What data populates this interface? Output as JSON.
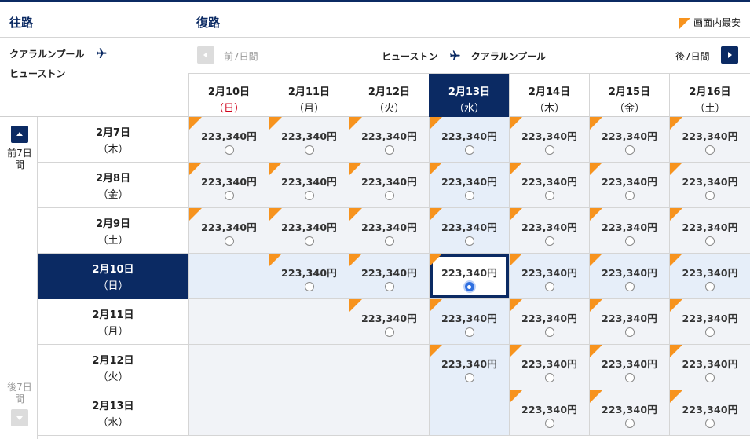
{
  "outbound_title": "往路",
  "return_title": "復路",
  "legend_label": "画面内最安",
  "colors": {
    "navy": "#0b2a63",
    "orange": "#f7931e",
    "red_date": "#d0021b"
  },
  "outbound_route": {
    "from": "クアラルンプール",
    "to": "ヒューストン"
  },
  "return_route": {
    "from": "ヒューストン",
    "to": "クアラルンプール"
  },
  "prev_week_label": "前7日間",
  "next_week_label": "後7日間",
  "side_prev_label": "前7日間",
  "side_next_label": "後7日間",
  "return_dates": [
    {
      "date": "2月10日",
      "dow": "（日）",
      "red": true
    },
    {
      "date": "2月11日",
      "dow": "（月）"
    },
    {
      "date": "2月12日",
      "dow": "（火）"
    },
    {
      "date": "2月13日",
      "dow": "（水）",
      "selected": true
    },
    {
      "date": "2月14日",
      "dow": "（木）"
    },
    {
      "date": "2月15日",
      "dow": "（金）"
    },
    {
      "date": "2月16日",
      "dow": "（土）"
    }
  ],
  "outbound_dates": [
    {
      "date": "2月7日",
      "dow": "（木）"
    },
    {
      "date": "2月8日",
      "dow": "（金）"
    },
    {
      "date": "2月9日",
      "dow": "（土）"
    },
    {
      "date": "2月10日",
      "dow": "（日）",
      "selected": true
    },
    {
      "date": "2月11日",
      "dow": "（月）"
    },
    {
      "date": "2月12日",
      "dow": "（火）"
    },
    {
      "date": "2月13日",
      "dow": "（水）"
    }
  ],
  "price": "223,340円",
  "grid": [
    [
      1,
      1,
      1,
      1,
      1,
      1,
      1
    ],
    [
      1,
      1,
      1,
      1,
      1,
      1,
      1
    ],
    [
      1,
      1,
      1,
      1,
      1,
      1,
      1
    ],
    [
      0,
      1,
      1,
      2,
      1,
      1,
      1
    ],
    [
      0,
      0,
      1,
      1,
      1,
      1,
      1
    ],
    [
      0,
      0,
      0,
      1,
      1,
      1,
      1
    ],
    [
      0,
      0,
      0,
      0,
      1,
      1,
      1
    ]
  ]
}
